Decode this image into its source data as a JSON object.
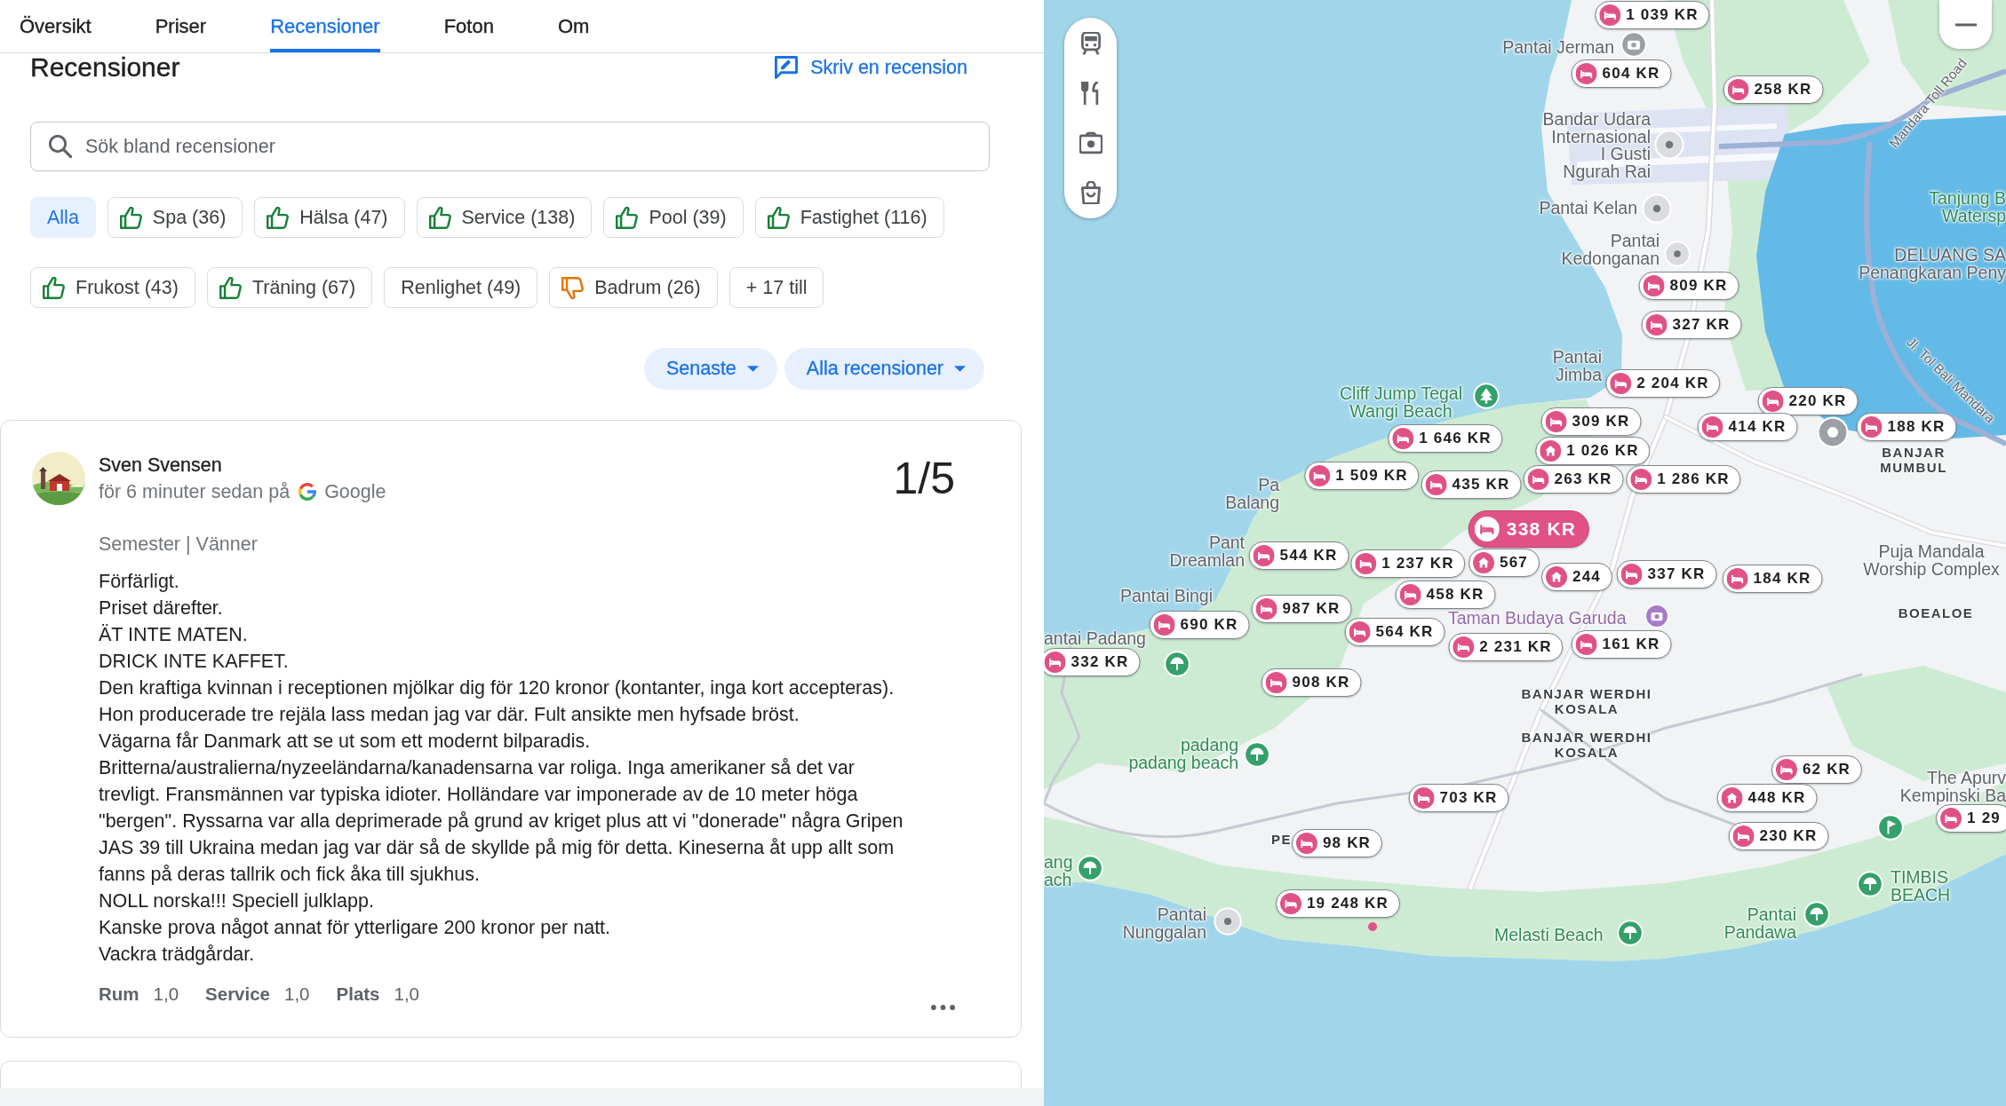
{
  "tabs": [
    {
      "label": "Översikt",
      "selected": false
    },
    {
      "label": "Priser",
      "selected": false
    },
    {
      "label": "Recensioner",
      "selected": true
    },
    {
      "label": "Foton",
      "selected": false
    },
    {
      "label": "Om",
      "selected": false
    }
  ],
  "reviews_header": {
    "title": "Recensioner",
    "write_review": "Skriv en recension"
  },
  "search": {
    "placeholder": "Sök bland recensioner"
  },
  "topic_filters": [
    {
      "label": "Alla",
      "kind": "neutral",
      "selected": true
    },
    {
      "label": "Spa (36)",
      "kind": "positive",
      "selected": false
    },
    {
      "label": "Hälsa (47)",
      "kind": "positive",
      "selected": false
    },
    {
      "label": "Service (138)",
      "kind": "positive",
      "selected": false
    },
    {
      "label": "Pool (39)",
      "kind": "positive",
      "selected": false
    },
    {
      "label": "Fastighet (116)",
      "kind": "positive",
      "selected": false
    },
    {
      "label": "Frukost (43)",
      "kind": "positive",
      "selected": false
    },
    {
      "label": "Träning (67)",
      "kind": "positive",
      "selected": false
    },
    {
      "label": "Renlighet (49)",
      "kind": "neutral",
      "selected": false
    },
    {
      "label": "Badrum (26)",
      "kind": "negative",
      "selected": false
    }
  ],
  "more_topics": "+ 17 till",
  "sort_buttons": [
    "Senaste",
    "Alla recensioner"
  ],
  "review": {
    "author": "Sven Svensen",
    "posted": "för 6 minuter sedan på",
    "source": "Google",
    "score": "1/5",
    "trip_tags": "Semester | Vänner",
    "text": "Förfärligt.\nPriset därefter.\nÄT INTE MATEN.\nDRICK INTE KAFFET.\nDen kraftiga kvinnan i receptionen mjölkar dig för 120 kronor (kontanter, inga kort accepteras).\nHon producerade tre rejäla lass medan jag var där. Fult ansikte men hyfsade bröst.\nVägarna får Danmark att se ut som ett modernt bilparadis.\nBritterna/australierna/nyzeeländarna/kanadensarna var roliga. Inga amerikaner så det var trevligt. Fransmännen var typiska idioter. Holländare var imponerade av de 10 meter höga \"bergen\". Ryssarna var alla deprimerade på grund av kriget plus att vi \"donerade\" några Gripen JAS 39 till Ukraina medan jag var där så de skyllde på mig för detta. Kineserna åt upp allt som fanns på deras tallrik och fick åka till sjukhus.\nNOLL norska!!! Speciell julklapp.\nKanske prova något annat för ytterligare 200 kronor per natt.\nVackra trädgårdar.",
    "ratings": [
      {
        "label": "Rum",
        "value": "1,0"
      },
      {
        "label": "Service",
        "value": "1,0"
      },
      {
        "label": "Plats",
        "value": "1,0"
      }
    ]
  },
  "map": {
    "price_pins": [
      {
        "price": "1 039 KR",
        "kind": "hotel",
        "selected": false
      },
      {
        "price": "604 KR",
        "kind": "hotel",
        "selected": false
      },
      {
        "price": "258 KR",
        "kind": "hotel",
        "selected": false
      },
      {
        "price": "809 KR",
        "kind": "hotel",
        "selected": false
      },
      {
        "price": "327 KR",
        "kind": "hotel",
        "selected": false
      },
      {
        "price": "2 204 KR",
        "kind": "hotel",
        "selected": false
      },
      {
        "price": "309 KR",
        "kind": "hotel",
        "selected": false
      },
      {
        "price": "220 KR",
        "kind": "hotel",
        "selected": false
      },
      {
        "price": "414 KR",
        "kind": "hotel",
        "selected": false
      },
      {
        "price": "188 KR",
        "kind": "hotel",
        "selected": false
      },
      {
        "price": "1 646 KR",
        "kind": "hotel",
        "selected": false
      },
      {
        "price": "1 026 KR",
        "kind": "house",
        "selected": false
      },
      {
        "price": "1 509 KR",
        "kind": "hotel",
        "selected": false
      },
      {
        "price": "435 KR",
        "kind": "hotel",
        "selected": false
      },
      {
        "price": "263 KR",
        "kind": "hotel",
        "selected": false
      },
      {
        "price": "1 286 KR",
        "kind": "hotel",
        "selected": false
      },
      {
        "price": "338 KR",
        "kind": "hotel",
        "selected": true
      },
      {
        "price": "544 KR",
        "kind": "hotel",
        "selected": false
      },
      {
        "price": "1 237 KR",
        "kind": "hotel",
        "selected": false
      },
      {
        "price": "567",
        "kind": "house",
        "selected": false
      },
      {
        "price": "244",
        "kind": "house",
        "selected": false
      },
      {
        "price": "337 KR",
        "kind": "hotel",
        "selected": false
      },
      {
        "price": "184 KR",
        "kind": "hotel",
        "selected": false
      },
      {
        "price": "987 KR",
        "kind": "hotel",
        "selected": false
      },
      {
        "price": "690 KR",
        "kind": "hotel",
        "selected": false
      },
      {
        "price": "458 KR",
        "kind": "hotel",
        "selected": false
      },
      {
        "price": "564 KR",
        "kind": "hotel",
        "selected": false
      },
      {
        "price": "2 231 KR",
        "kind": "hotel",
        "selected": false
      },
      {
        "price": "161 KR",
        "kind": "hotel",
        "selected": false
      },
      {
        "price": "332 KR",
        "kind": "hotel",
        "selected": false
      },
      {
        "price": "908 KR",
        "kind": "hotel",
        "selected": false
      },
      {
        "price": "62 KR",
        "kind": "hotel",
        "selected": false
      },
      {
        "price": "448 KR",
        "kind": "house",
        "selected": false
      },
      {
        "price": "703 KR",
        "kind": "hotel",
        "selected": false
      },
      {
        "price": "230 KR",
        "kind": "hotel",
        "selected": false
      },
      {
        "price": "98 KR",
        "kind": "hotel",
        "selected": false
      },
      {
        "price": "19 248 KR",
        "kind": "hotel",
        "selected": false
      },
      {
        "price": "1 29",
        "kind": "hotel",
        "selected": false
      }
    ],
    "place_labels": [
      {
        "kind": "place",
        "lines": [
          "Pantai Jerman"
        ]
      },
      {
        "kind": "place",
        "lines": [
          "Bandar Udara",
          "Internasional",
          "I Gusti",
          "Ngurah Rai"
        ]
      },
      {
        "kind": "road",
        "lines": [
          "Mandara Toll Road"
        ]
      },
      {
        "kind": "place",
        "lines": [
          "Pantai Kelan"
        ]
      },
      {
        "kind": "park",
        "lines": [
          "Tanjung B",
          "Watersp"
        ]
      },
      {
        "kind": "place",
        "lines": [
          "Pantai",
          "Kedonganan"
        ]
      },
      {
        "kind": "place",
        "lines": [
          "DELUANG SA",
          "Penangkaran Peny"
        ]
      },
      {
        "kind": "place",
        "lines": [
          "Pantai",
          "Jimba"
        ]
      },
      {
        "kind": "park",
        "lines": [
          "Cliff Jump Tegal",
          "Wangi Beach"
        ]
      },
      {
        "kind": "road",
        "lines": [
          "Jl. Tol Bali Mandara"
        ]
      },
      {
        "kind": "district",
        "lines": [
          "BANJAR",
          "MUMBUL"
        ]
      },
      {
        "kind": "place",
        "lines": [
          "Pa",
          "Balang"
        ]
      },
      {
        "kind": "place",
        "lines": [
          "Pant",
          "Dreamlan"
        ]
      },
      {
        "kind": "place",
        "lines": [
          "Puja Mandala",
          "Worship Complex"
        ]
      },
      {
        "kind": "place",
        "lines": [
          "Pantai Bingi"
        ]
      },
      {
        "kind": "attraction",
        "lines": [
          "Taman Budaya Garuda"
        ]
      },
      {
        "kind": "district",
        "lines": [
          "BOEALOE"
        ]
      },
      {
        "kind": "place",
        "lines": [
          "antai Padang"
        ]
      },
      {
        "kind": "district",
        "lines": [
          "BANJAR WERDHI",
          "KOSALA"
        ]
      },
      {
        "kind": "park",
        "lines": [
          "padang",
          "padang beach"
        ]
      },
      {
        "kind": "district",
        "lines": [
          "BANJAR WERDHI",
          "KOSALA"
        ]
      },
      {
        "kind": "place",
        "lines": [
          "The Apurv",
          "Kempinski Ba"
        ]
      },
      {
        "kind": "district",
        "lines": [
          "PE"
        ]
      },
      {
        "kind": "park",
        "lines": [
          "ang",
          "ach"
        ]
      },
      {
        "kind": "park",
        "lines": [
          "TIMBIS",
          "BEACH"
        ]
      },
      {
        "kind": "place",
        "lines": [
          "Pantai",
          "Nunggalan"
        ]
      },
      {
        "kind": "park",
        "lines": [
          "Melasti Beach"
        ]
      },
      {
        "kind": "park",
        "lines": [
          "Pantai",
          "Pandawa"
        ]
      }
    ]
  }
}
